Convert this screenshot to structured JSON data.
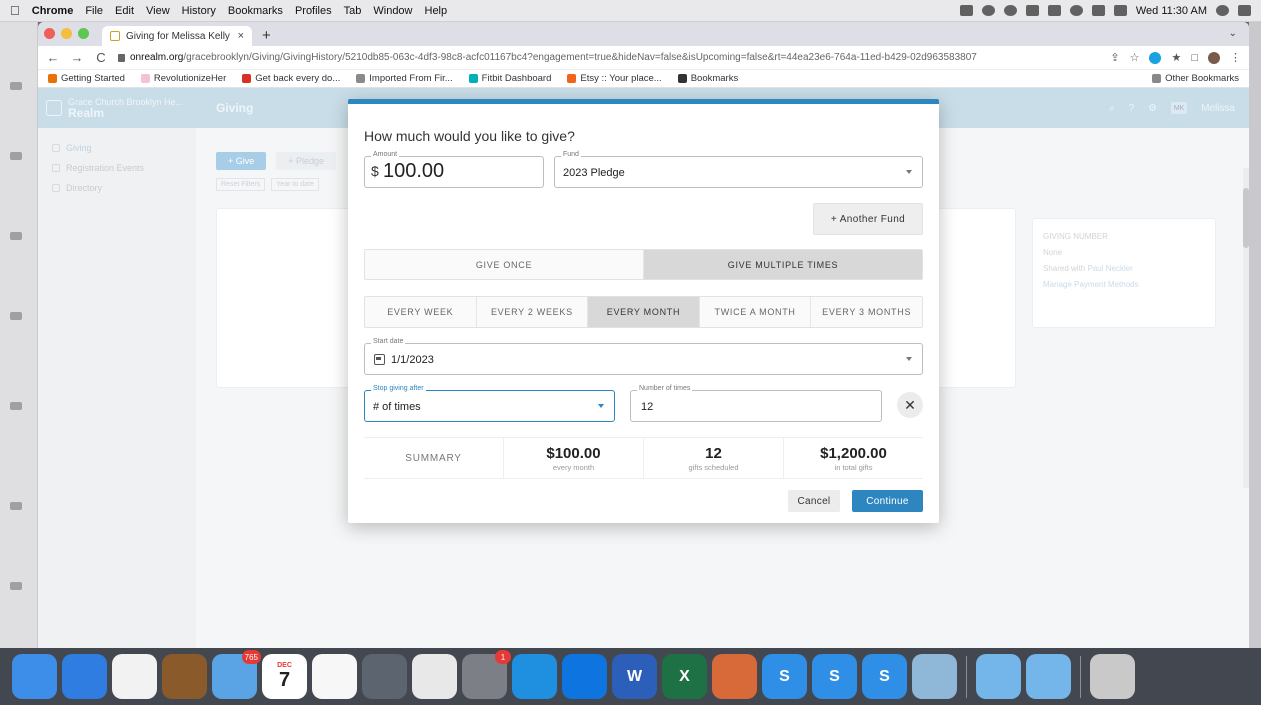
{
  "menubar": {
    "app": "Chrome",
    "items": [
      "File",
      "Edit",
      "View",
      "History",
      "Bookmarks",
      "Profiles",
      "Tab",
      "Window",
      "Help"
    ],
    "clock": "Wed 11:30 AM"
  },
  "browser": {
    "tab_title": "Giving for Melissa Kelly",
    "url_host": "onrealm.org",
    "url_path": "/gracebrooklyn/Giving/GivingHistory/5210db85-063c-4df3-98c8-acfc01167bc4?engagement=true&hideNav=false&isUpcoming=false&rt=44ea23e6-764a-11ed-b429-02d963583807",
    "bookmarks": [
      {
        "label": "Getting Started",
        "color": "#e8710a"
      },
      {
        "label": "RevolutionizeHer",
        "color": "#f4c2d7"
      },
      {
        "label": "Get back every do...",
        "color": "#d93025"
      },
      {
        "label": "Imported From Fir...",
        "color": "#8a8a8a"
      },
      {
        "label": "Fitbit Dashboard",
        "color": "#00b0b9"
      },
      {
        "label": "Etsy :: Your place...",
        "color": "#f1641e"
      },
      {
        "label": "Bookmarks",
        "color": "#333333"
      }
    ],
    "other_bookmarks": "Other Bookmarks"
  },
  "realm": {
    "brand_small": "Grace Church Brooklyn He...",
    "brand": "Realm",
    "section": "Giving",
    "user_initials": "MK",
    "user_name": "Melissa",
    "nav": [
      "Giving",
      "Registration Events",
      "Directory"
    ],
    "toolbar": {
      "give": "+ Give",
      "pledge": "+ Pledge"
    },
    "filters": [
      "Reset Filters",
      "Year to date"
    ],
    "side_card": {
      "title": "GIVING NUMBER",
      "value": "None",
      "shared_prefix": "Shared with",
      "shared_name": "Paul Neckler",
      "manage": "Manage Payment Methods"
    }
  },
  "modal": {
    "title": "How much would you like to give?",
    "amount": {
      "label": "Amount",
      "currency": "$",
      "value": "100.00"
    },
    "fund": {
      "label": "Fund",
      "value": "2023 Pledge"
    },
    "another_fund": "+ Another Fund",
    "frequency_options": [
      "GIVE ONCE",
      "GIVE MULTIPLE TIMES"
    ],
    "frequency_selected": 1,
    "interval_options": [
      "EVERY WEEK",
      "EVERY 2 WEEKS",
      "EVERY MONTH",
      "TWICE A MONTH",
      "EVERY 3 MONTHS"
    ],
    "interval_selected": 2,
    "start_date": {
      "label": "Start date",
      "value": "1/1/2023"
    },
    "stop_after": {
      "label": "Stop giving after",
      "value": "# of times"
    },
    "number_of_times": {
      "label": "Number of times",
      "value": "12"
    },
    "summary": {
      "label": "SUMMARY",
      "amount": "$100.00",
      "amount_sub": "every month",
      "count": "12",
      "count_sub": "gifts scheduled",
      "total": "$1,200.00",
      "total_sub": "in total gifts"
    },
    "cancel": "Cancel",
    "continue": "Continue",
    "accent": "#2e86c1"
  },
  "dock": {
    "apps": [
      {
        "name": "finder-icon",
        "color": "#3d8ee8",
        "glyph": ""
      },
      {
        "name": "safari-icon",
        "color": "#2f7de1",
        "glyph": ""
      },
      {
        "name": "chrome-icon",
        "color": "#f2f2f2",
        "glyph": ""
      },
      {
        "name": "notebook-icon",
        "color": "#8a5a2b",
        "glyph": ""
      },
      {
        "name": "mail-icon",
        "color": "#5aa4e6",
        "glyph": "",
        "badge": "765"
      },
      {
        "name": "calendar-icon",
        "color": "#ffffff",
        "glyph": "7",
        "cal_month": "DEC"
      },
      {
        "name": "photos-icon",
        "color": "#f7f7f7",
        "glyph": ""
      },
      {
        "name": "image-capture-icon",
        "color": "#5c6470",
        "glyph": ""
      },
      {
        "name": "textedit-icon",
        "color": "#e8e8e8",
        "glyph": ""
      },
      {
        "name": "system-preferences-icon",
        "color": "#7c7f86",
        "glyph": "",
        "badge": "1"
      },
      {
        "name": "remote-icon",
        "color": "#1f8fe0",
        "glyph": ""
      },
      {
        "name": "teamviewer-icon",
        "color": "#0e75e0",
        "glyph": ""
      },
      {
        "name": "word-icon",
        "color": "#2b5fb9",
        "glyph": "W"
      },
      {
        "name": "excel-icon",
        "color": "#1e7145",
        "glyph": "X"
      },
      {
        "name": "paintbrush-icon",
        "color": "#d86a3a",
        "glyph": ""
      },
      {
        "name": "scansnap-icon",
        "color": "#2f8fe6",
        "glyph": "S"
      },
      {
        "name": "scansnap-home-icon",
        "color": "#2f8fe6",
        "glyph": "S"
      },
      {
        "name": "scansnap-manager-icon",
        "color": "#2f8fe6",
        "glyph": "S"
      },
      {
        "name": "folder-icon",
        "color": "#8fb8d8",
        "glyph": ""
      },
      {
        "name": "documents-folder-icon",
        "color": "#74b6ea",
        "glyph": ""
      },
      {
        "name": "downloads-folder-icon",
        "color": "#74b6ea",
        "glyph": ""
      },
      {
        "name": "trash-icon",
        "color": "#c9c9c9",
        "glyph": ""
      }
    ]
  }
}
